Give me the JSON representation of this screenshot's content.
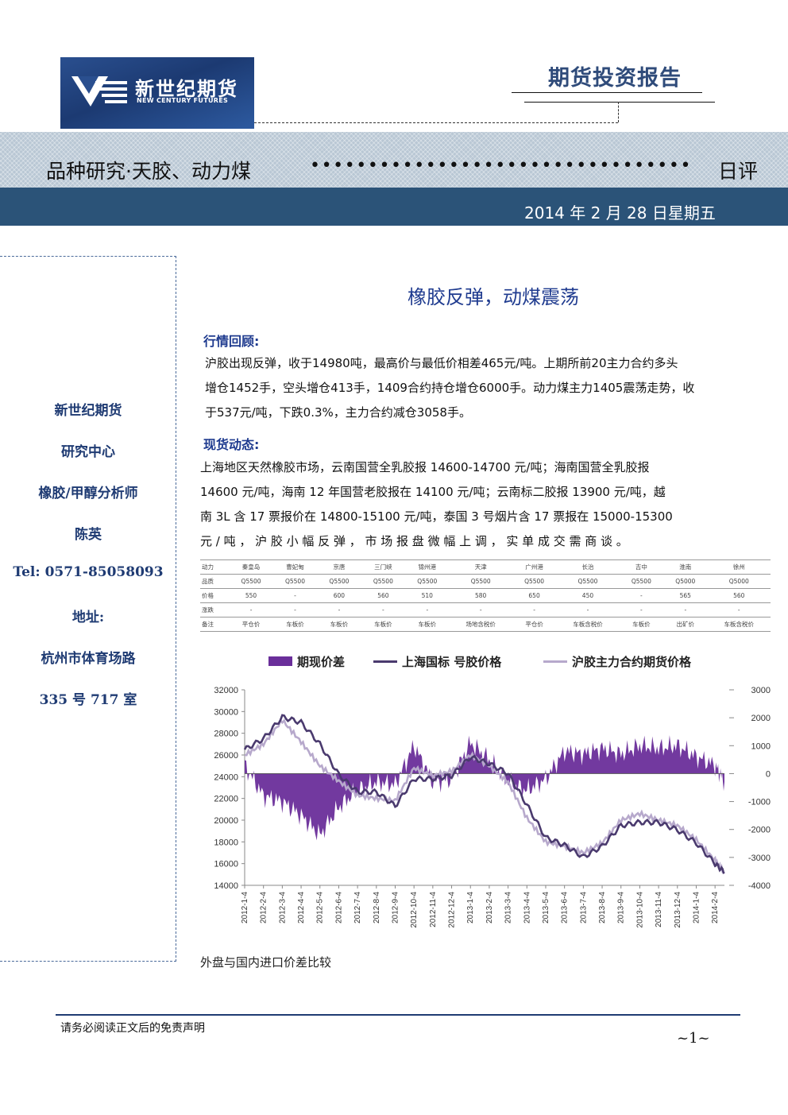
{
  "header": {
    "logo_cn": "新世纪期货",
    "logo_en": "NEW CENTURY FUTURES",
    "report_type": "期货投资报告",
    "band_title": "品种研究·天胶、动力煤",
    "band_dots": "•••••••••••••••••••••••••••••••••",
    "band_end": "日评",
    "date": "2014 年 2 月 28 日星期五"
  },
  "sidebar": {
    "company": "新世纪期货",
    "dept": "研究中心",
    "role": "橡胶/甲醇分析师",
    "name": "陈英",
    "tel": "Tel: 0571-85058093",
    "address_label": "地址:",
    "address_1": "杭州市体育场路",
    "address_2": "335 号 717 室"
  },
  "main": {
    "title": "橡胶反弹，动煤震荡",
    "section1": "行情回顾:",
    "review": [
      "沪胶出现反弹，收于14980吨，最高价与最低价相差465元/吨。上期所前20主力合约多头",
      "增仓1452手，空头增仓413手，1409合约持仓增仓6000手。动力煤主力1405震荡走势，收",
      "于537元/吨，下跌0.3%，主力合约减仓3058手。"
    ],
    "section2": "现货动态:",
    "spot": [
      "上海地区天然橡胶市场，云南国营全乳胶报 14600-14700 元/吨；海南国营全乳胶报",
      "14600 元/吨，海南 12 年国营老胶报在 14100 元/吨；云南标二胶报 13900 元/吨，越",
      "南 3L 含 17 票报价在 14800-15100 元/吨，泰国 3 号烟片含 17 票报在 15000-15300",
      "元 / 吨 ， 沪 胶 小 幅 反 弹 ， 市 场 报 盘 微 幅 上 调 ， 实 单 成 交 需 商 谈 。"
    ],
    "table": [
      [
        "动力",
        "秦皇岛",
        "曹妃甸",
        "京唐",
        "三门峡",
        "锦州港",
        "天津",
        "广州港",
        "长治",
        "吉中",
        "淮南",
        "徐州"
      ],
      [
        "品质",
        "Q5500",
        "Q5500",
        "Q5500",
        "Q5500",
        "Q5500",
        "Q5500",
        "Q5500",
        "Q5500",
        "Q5500",
        "Q5000",
        "Q5000"
      ],
      [
        "价格",
        "550",
        "-",
        "600",
        "560",
        "510",
        "580",
        "650",
        "450",
        "-",
        "565",
        "560"
      ],
      [
        "涨跌",
        "-",
        "-",
        "-",
        "-",
        "-",
        "-",
        "-",
        "-",
        "-",
        "-",
        "-"
      ],
      [
        "备注",
        "平仓价",
        "车板价",
        "车板价",
        "车板价",
        "车板价",
        "场地含税价",
        "平仓价",
        "车板含税价",
        "车板价",
        "出矿价",
        "车板含税价"
      ]
    ],
    "caption": "外盘与国内进口价差比较"
  },
  "colors": {
    "spread": "#6a2e9a",
    "sh_intl": "#4a3a6e",
    "shfe": "#b7a9cc",
    "navy": "#2b5378"
  },
  "chart_data": {
    "type": "area+line",
    "legend": [
      "期现价差",
      "上海国标一号胶价格",
      "沪胶主力合约期货价格"
    ],
    "legend_display": [
      "期现价差",
      "上海国标  号胶价格",
      "沪胶主力合约期货价格"
    ],
    "y_left": {
      "min": 14000,
      "max": 32000,
      "ticks": [
        "32000",
        "30000",
        "28000",
        "26000",
        "24000",
        "22000",
        "20000",
        "18000",
        "16000",
        "14000"
      ]
    },
    "y_right": {
      "min": -4000,
      "max": 3000,
      "ticks": [
        "3000",
        "2000",
        "1000",
        "0",
        "-1000",
        "-2000",
        "-3000",
        "-4000"
      ]
    },
    "x_ticks": [
      "2012-1-4",
      "2012-2-4",
      "2012-3-4",
      "2012-4-4",
      "2012-5-4",
      "2012-6-4",
      "2012-7-4",
      "2012-8-4",
      "2012-9-4",
      "2012-10-4",
      "2012-11-4",
      "2012-12-4",
      "2013-1-4",
      "2013-2-4",
      "2013-3-4",
      "2013-4-4",
      "2013-5-4",
      "2013-6-4",
      "2013-7-4",
      "2013-8-4",
      "2013-9-4",
      "2013-10-4",
      "2013-11-4",
      "2013-12-4",
      "2014-1-4",
      "2014-2-4"
    ],
    "spot_price": [
      [
        0,
        26500
      ],
      [
        1,
        27500
      ],
      [
        2,
        29500
      ],
      [
        3,
        29000
      ],
      [
        4,
        27000
      ],
      [
        5,
        24200
      ],
      [
        6,
        22600
      ],
      [
        7,
        22600
      ],
      [
        8,
        21300
      ],
      [
        9,
        23800
      ],
      [
        10,
        23800
      ],
      [
        11,
        24100
      ],
      [
        12,
        25800
      ],
      [
        13,
        25200
      ],
      [
        14,
        24300
      ],
      [
        15,
        21400
      ],
      [
        16,
        18400
      ],
      [
        17,
        17700
      ],
      [
        18,
        16600
      ],
      [
        19,
        17600
      ],
      [
        20,
        19500
      ],
      [
        21,
        19800
      ],
      [
        22,
        19800
      ],
      [
        23,
        19100
      ],
      [
        24,
        17900
      ],
      [
        25,
        16000
      ],
      [
        25.5,
        15200
      ]
    ],
    "futures_price": [
      [
        0,
        26000
      ],
      [
        1,
        27000
      ],
      [
        2,
        29200
      ],
      [
        3,
        27200
      ],
      [
        4,
        25000
      ],
      [
        5,
        23600
      ],
      [
        6,
        22300
      ],
      [
        7,
        22000
      ],
      [
        8,
        21800
      ],
      [
        9,
        24800
      ],
      [
        10,
        24100
      ],
      [
        11,
        24500
      ],
      [
        12,
        26000
      ],
      [
        13,
        25000
      ],
      [
        14,
        23500
      ],
      [
        15,
        20200
      ],
      [
        16,
        18000
      ],
      [
        17,
        17600
      ],
      [
        18,
        17000
      ],
      [
        19,
        17900
      ],
      [
        20,
        20000
      ],
      [
        21,
        20600
      ],
      [
        22,
        20000
      ],
      [
        23,
        19500
      ],
      [
        24,
        18200
      ],
      [
        25,
        16300
      ],
      [
        25.5,
        15100
      ]
    ],
    "spread": [
      [
        0,
        300
      ],
      [
        1,
        -800
      ],
      [
        2,
        -1000
      ],
      [
        3,
        -1500
      ],
      [
        4,
        -2200
      ],
      [
        5,
        -1200
      ],
      [
        6,
        -600
      ],
      [
        7,
        -300
      ],
      [
        8,
        -400
      ],
      [
        9,
        1000
      ],
      [
        10,
        -300
      ],
      [
        11,
        -200
      ],
      [
        12,
        1100
      ],
      [
        13,
        500
      ],
      [
        14,
        -300
      ],
      [
        15,
        -600
      ],
      [
        16,
        -200
      ],
      [
        17,
        800
      ],
      [
        18,
        700
      ],
      [
        19,
        900
      ],
      [
        20,
        700
      ],
      [
        21,
        1000
      ],
      [
        22,
        900
      ],
      [
        23,
        1000
      ],
      [
        24,
        600
      ],
      [
        25,
        300
      ],
      [
        25.5,
        -300
      ]
    ]
  }
}
